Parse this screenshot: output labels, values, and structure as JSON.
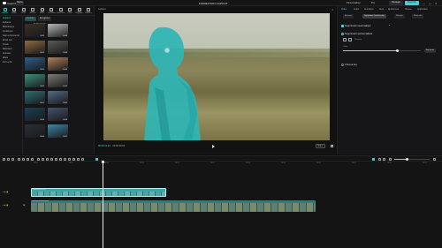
{
  "app": {
    "name": "CapCut",
    "menu_label": "Menu",
    "project_title": "FORMATION CAPCUT"
  },
  "topbar": {
    "pro_label": "Personnaliser",
    "pro2_label": "Pro",
    "share_label": "Partager",
    "export_label": "Exporter",
    "win_controls": [
      "—",
      "▢",
      "✕"
    ]
  },
  "colors": {
    "accent": "#3fd3d3",
    "background": "#0f0f10",
    "panel": "#161618",
    "clip_video": "#3aa7a7",
    "clip_main": "#2a7c82"
  },
  "media_toolbar": [
    {
      "label": "Importer",
      "icon": "import-icon",
      "active": true
    },
    {
      "label": "Audio",
      "icon": "audio-icon",
      "active": false
    },
    {
      "label": "Texte",
      "icon": "text-icon",
      "active": false
    },
    {
      "label": "Stickers",
      "icon": "sticker-icon",
      "active": false
    },
    {
      "label": "Effets",
      "icon": "effects-icon",
      "active": false
    },
    {
      "label": "Transitions",
      "icon": "transition-icon",
      "active": false
    },
    {
      "label": "Sous-titres",
      "icon": "subtitle-icon",
      "active": false
    },
    {
      "label": "Filtres",
      "icon": "filter-icon",
      "active": false
    },
    {
      "label": "Réglages",
      "icon": "adjust-icon",
      "active": false
    },
    {
      "label": "Modèles",
      "icon": "template-icon",
      "active": false
    }
  ],
  "media_nav": [
    "Appareil",
    "Espaces",
    "Bibliothèque",
    "Tendances",
    "Noël et Nouvel An",
    "Écran vert",
    "Fonds",
    "Matériaux",
    "Animaux",
    "Effets",
    "Intro et fin"
  ],
  "media_nav_selected": 0,
  "media_tabs": {
    "tab1": "Importer",
    "tab2": "Enregistrer",
    "sort_label": "Activité récente"
  },
  "thumbnails": [
    {
      "color": "#3a2f26",
      "dur": "00:05"
    },
    {
      "color": "#b7b9b6",
      "dur": "00:08"
    },
    {
      "color": "#8e6a3f",
      "dur": "00:12"
    },
    {
      "color": "#5a5b52",
      "dur": "00:06"
    },
    {
      "color": "#2e5f8a",
      "dur": "00:10"
    },
    {
      "color": "#b0815a",
      "dur": "00:04"
    },
    {
      "color": "#3f8f7e",
      "dur": "00:07"
    },
    {
      "color": "#7a7a75",
      "dur": "00:09"
    },
    {
      "color": "#2c7072",
      "dur": "00:11"
    },
    {
      "color": "#546b85",
      "dur": "00:05"
    },
    {
      "color": "#1c3e57",
      "dur": "00:06"
    },
    {
      "color": "#44536e",
      "dur": "00:08"
    },
    {
      "color": "#2a2f3a",
      "dur": "00:03"
    },
    {
      "color": "#3d84a8",
      "dur": "00:07"
    }
  ],
  "player": {
    "label": "Lecteur",
    "current_time": "00:00:13:23",
    "total_time": "00:00:30:00",
    "ratio_label": "Ratio"
  },
  "inspector": {
    "tabs": [
      "Vidéo",
      "Audio",
      "Animation",
      "Suivi",
      "Ajustement",
      "Vitesse",
      "Application"
    ],
    "selected_tab": 0,
    "subtabs": [
      "Basique",
      "Supprimer l'arrière-plan",
      "Masque",
      "Retouche"
    ],
    "selected_subtab": 1,
    "section1": "Suppression automatique",
    "section2": "Suppression personnalisée",
    "brush_label": "Pinceau",
    "size_label": "Taille",
    "size_value": 0.7,
    "apply_label": "Appliquer",
    "section3": "Chroma key"
  },
  "timeline": {
    "ruler": [
      "00:00",
      "00:05",
      "00:10",
      "00:15",
      "00:20",
      "00:25",
      "00:30",
      "00:35",
      "00:40",
      "00:45",
      "00:50",
      "00:55"
    ],
    "track1_label": "▸ ◉ 🔒",
    "track2_label": "▸ ◉ 🔒",
    "clip1_name": "Vidéo 00:00:12:03",
    "clip2_name": "Couverture 00:00:30:00"
  }
}
